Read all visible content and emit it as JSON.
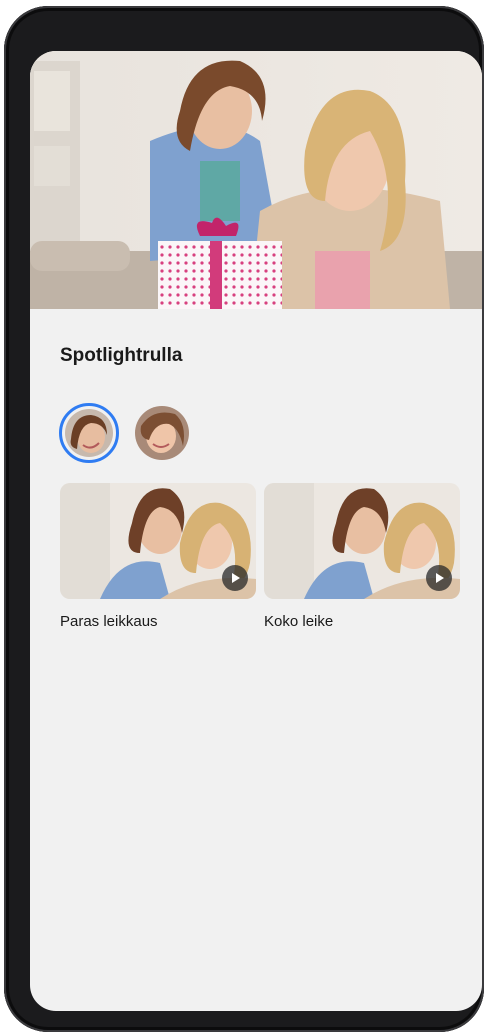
{
  "spotlight": {
    "title": "Spotlightrulla",
    "people": [
      {
        "name": "girl",
        "selected": true
      },
      {
        "name": "woman",
        "selected": false
      }
    ],
    "clips": [
      {
        "label": "Paras leikkaus",
        "icon": "play-icon"
      },
      {
        "label": "Koko leike",
        "icon": "play-icon"
      }
    ]
  },
  "colors": {
    "accent": "#2f7cf2",
    "background": "#f1f1f1",
    "text": "#1a1a1a"
  }
}
